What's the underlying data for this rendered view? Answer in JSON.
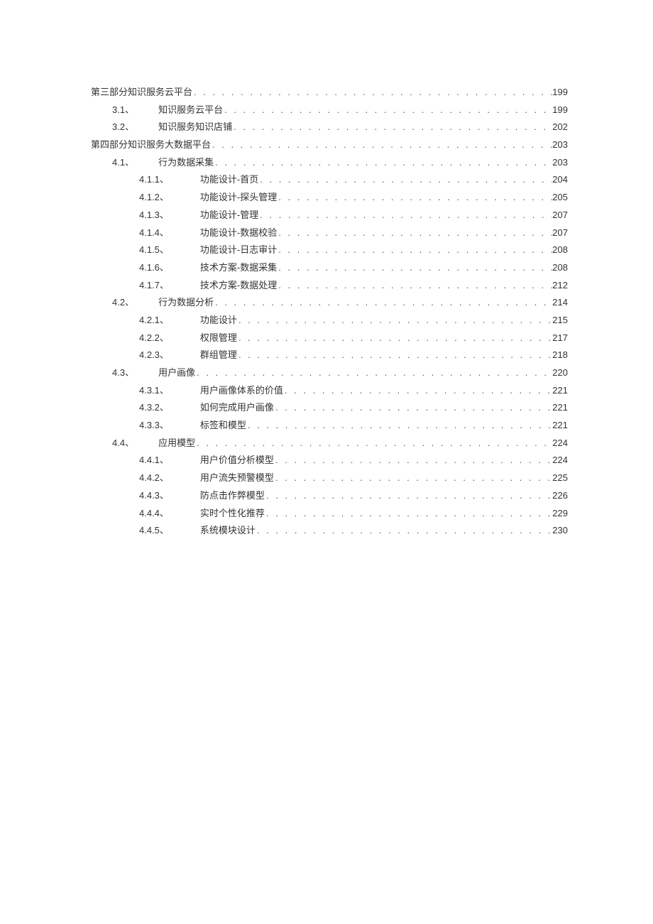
{
  "toc": [
    {
      "level": 0,
      "label": "第三部分知识服务云平台",
      "title": "",
      "page": "199"
    },
    {
      "level": 1,
      "label": "3.1、",
      "title": "知识服务云平台",
      "page": "199"
    },
    {
      "level": 1,
      "label": "3.2、",
      "title": "知识服务知识店铺",
      "page": "202"
    },
    {
      "level": 0,
      "label": "第四部分知识服务大数据平台",
      "title": "",
      "page": "203"
    },
    {
      "level": 1,
      "label": "4.1、",
      "title": "行为数据采集",
      "page": "203"
    },
    {
      "level": 2,
      "label": "4.1.1、",
      "title": "功能设计-首页",
      "page": "204"
    },
    {
      "level": 2,
      "label": "4.1.2、",
      "title": "功能设计-探头管理",
      "page": "205"
    },
    {
      "level": 2,
      "label": "4.1.3、",
      "title": "功能设计-管理",
      "page": "207"
    },
    {
      "level": 2,
      "label": "4.1.4、",
      "title": "功能设计-数据校验",
      "page": "207"
    },
    {
      "level": 2,
      "label": "4.1.5、",
      "title": "功能设计-日志审计",
      "page": "208"
    },
    {
      "level": 2,
      "label": "4.1.6、",
      "title": "技术方案-数据采集",
      "page": "208"
    },
    {
      "level": 2,
      "label": "4.1.7、",
      "title": "技术方案-数据处理",
      "page": "212"
    },
    {
      "level": 1,
      "label": "4.2、",
      "title": "行为数据分析",
      "page": "214"
    },
    {
      "level": 2,
      "label": "4.2.1、",
      "title": "功能设计",
      "page": "215"
    },
    {
      "level": 2,
      "label": "4.2.2、",
      "title": "权限管理",
      "page": "217"
    },
    {
      "level": 2,
      "label": "4.2.3、",
      "title": "群组管理",
      "page": "218"
    },
    {
      "level": 1,
      "label": "4.3、",
      "title": "用户画像",
      "page": "220"
    },
    {
      "level": 2,
      "label": "4.3.1、",
      "title": "用户画像体系的价值",
      "page": "221"
    },
    {
      "level": 2,
      "label": "4.3.2、",
      "title": "如何完成用户画像",
      "page": "221"
    },
    {
      "level": 2,
      "label": "4.3.3、",
      "title": "标签和模型",
      "page": "221"
    },
    {
      "level": 1,
      "label": "4.4、",
      "title": "应用模型",
      "page": "224"
    },
    {
      "level": 2,
      "label": "4.4.1、",
      "title": "用户价值分析模型",
      "page": "224"
    },
    {
      "level": 2,
      "label": "4.4.2、",
      "title": "用户流失预警模型",
      "page": "225"
    },
    {
      "level": 2,
      "label": "4.4.3、",
      "title": "防点击作弊模型",
      "page": "226"
    },
    {
      "level": 2,
      "label": "4.4.4、",
      "title": "实时个性化推荐",
      "page": "229"
    },
    {
      "level": 2,
      "label": "4.4.5、",
      "title": "系统模块设计",
      "page": "230"
    }
  ]
}
